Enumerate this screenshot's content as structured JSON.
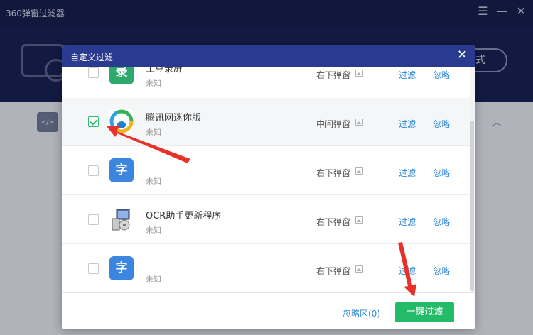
{
  "app": {
    "title": "360弹窗过滤器",
    "controls": [
      "☰",
      "—",
      "✕"
    ],
    "hero_button": "式",
    "body_icon": "</>"
  },
  "modal": {
    "title": "自定义过滤",
    "close": "✕",
    "rows": [
      {
        "name": "土豆录屏",
        "status": "未知",
        "type": "右下弹窗",
        "filter": "过滤",
        "ignore": "忽略",
        "icon_glyph": "录",
        "icon": "recorder-app-icon",
        "checked": false
      },
      {
        "name": "腾讯网迷你版",
        "status": "未知",
        "type": "中间弹窗",
        "filter": "过滤",
        "ignore": "忽略",
        "icon_glyph": "",
        "icon": "tencent-news-icon",
        "checked": true
      },
      {
        "name": "",
        "status": "未知",
        "type": "右下弹窗",
        "filter": "过滤",
        "ignore": "忽略",
        "icon_glyph": "字",
        "icon": "font-app-icon",
        "checked": false
      },
      {
        "name": "OCR助手更新程序",
        "status": "未知",
        "type": "右下弹窗",
        "filter": "过滤",
        "ignore": "忽略",
        "icon_glyph": "",
        "icon": "ocr-installer-icon",
        "checked": false
      },
      {
        "name": "",
        "status": "未知",
        "type": "右下弹窗",
        "filter": "过滤",
        "ignore": "忽略",
        "icon_glyph": "字",
        "icon": "font-app-icon",
        "checked": false
      }
    ],
    "footer": {
      "ignore_zone": "忽略区(0)",
      "filter_all": "一键过滤"
    }
  },
  "colors": {
    "header": "#2a3b8f",
    "accent_green": "#23bb68",
    "link_blue": "#2a86d8",
    "annotation_red": "#e8312a"
  }
}
